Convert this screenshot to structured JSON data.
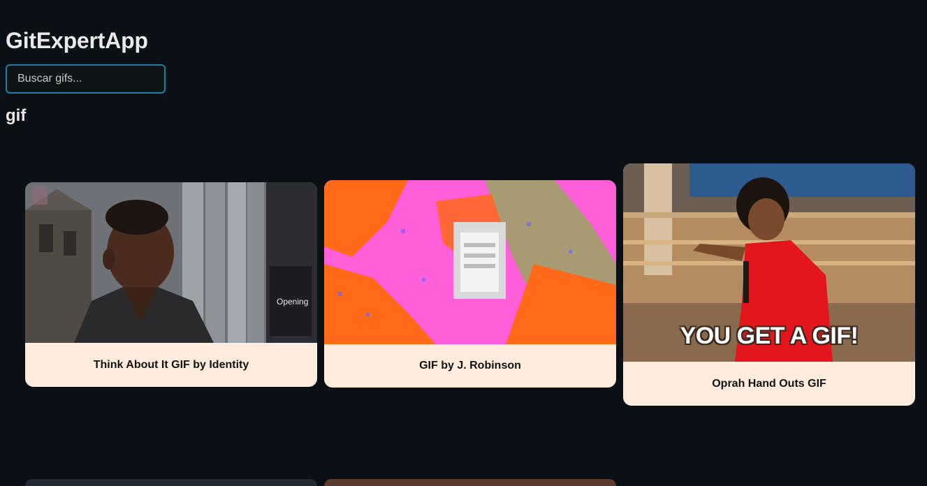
{
  "app": {
    "title": "GitExpertApp"
  },
  "search": {
    "placeholder": "Buscar gifs..."
  },
  "category": {
    "title": "gif"
  },
  "cards": [
    {
      "caption": "Think About It GIF by Identity"
    },
    {
      "caption": "GIF by J. Robinson"
    },
    {
      "caption": "Oprah Hand Outs GIF",
      "image_text": "YOU GET A GIF!"
    }
  ],
  "colors": {
    "background": "#0b1017",
    "card_caption_bg": "#ffecdc",
    "input_border": "#1f7fa6"
  }
}
